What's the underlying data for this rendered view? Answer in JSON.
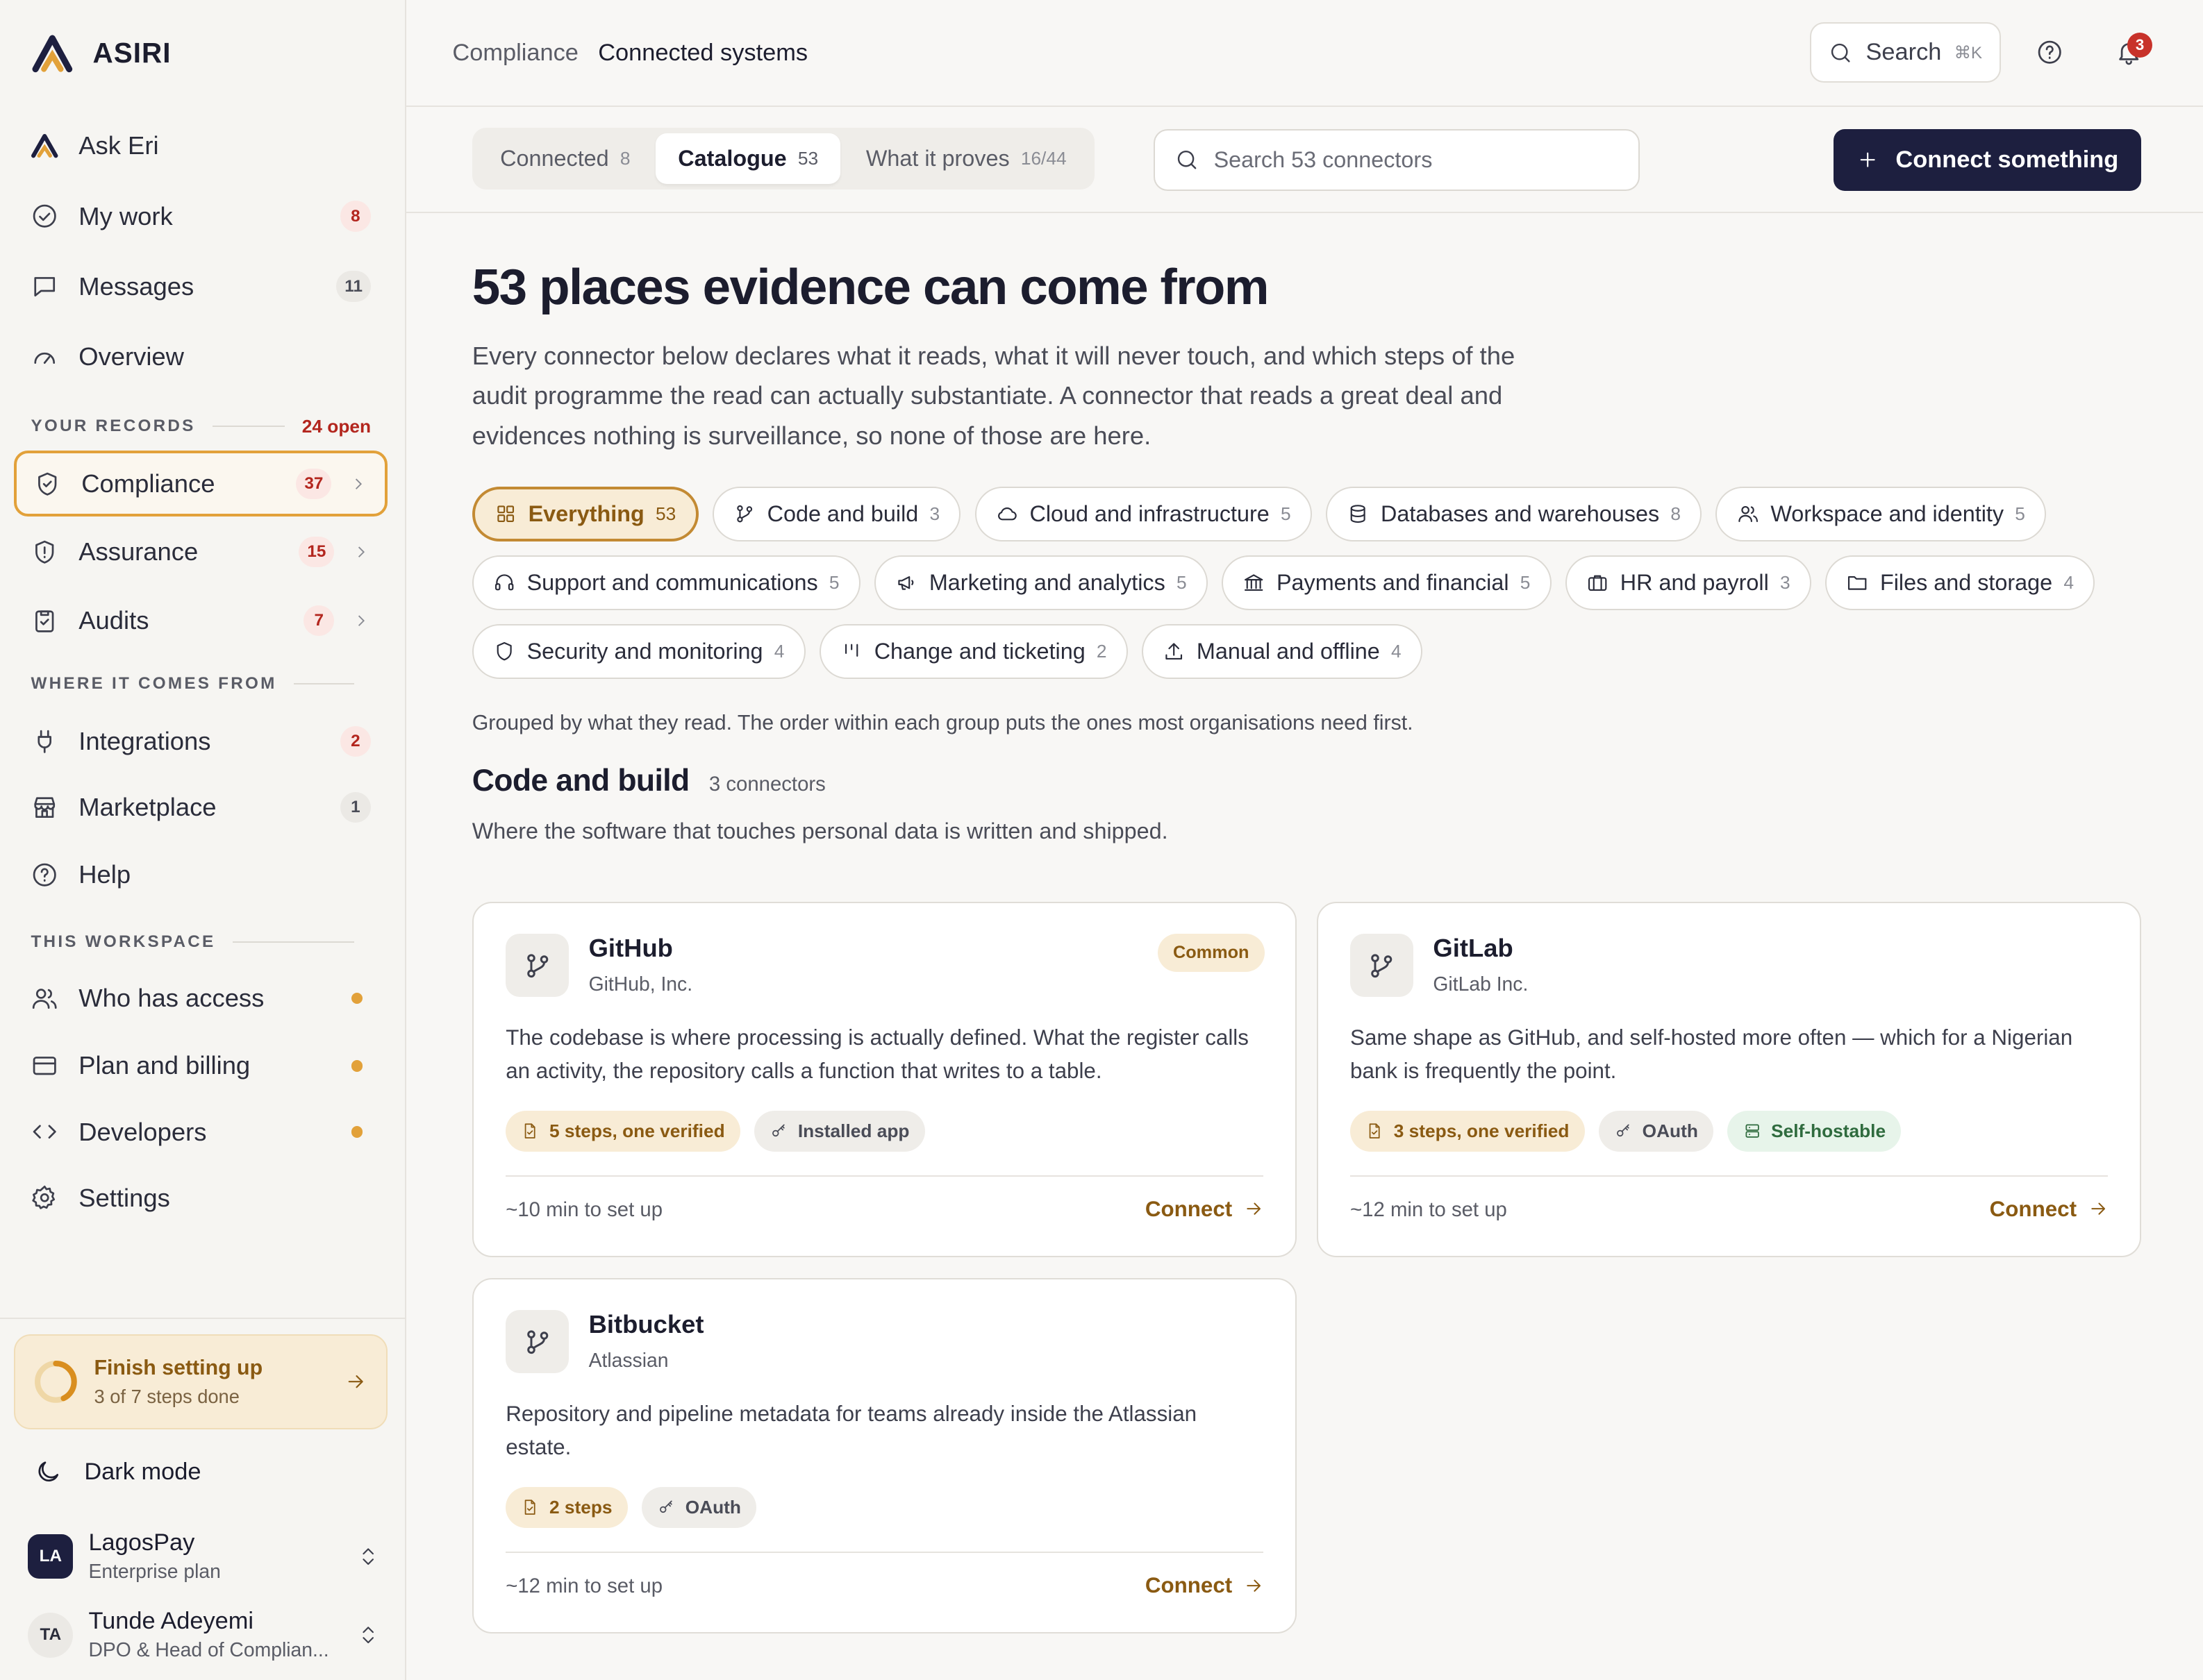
{
  "brand": {
    "name": "ASIRI"
  },
  "sidebar": {
    "top_items": [
      {
        "label": "Ask Eri"
      },
      {
        "label": "My work",
        "badge": "8"
      },
      {
        "label": "Messages",
        "badge": "11"
      },
      {
        "label": "Overview"
      }
    ],
    "records": {
      "heading": "YOUR RECORDS",
      "open": "24 open",
      "items": [
        {
          "label": "Compliance",
          "badge": "37"
        },
        {
          "label": "Assurance",
          "badge": "15"
        },
        {
          "label": "Audits",
          "badge": "7"
        }
      ]
    },
    "sources": {
      "heading": "WHERE IT COMES FROM",
      "items": [
        {
          "label": "Integrations",
          "badge": "2"
        },
        {
          "label": "Marketplace",
          "badge": "1"
        },
        {
          "label": "Help"
        }
      ]
    },
    "workspace": {
      "heading": "THIS WORKSPACE",
      "items": [
        {
          "label": "Who has access"
        },
        {
          "label": "Plan and billing"
        },
        {
          "label": "Developers"
        },
        {
          "label": "Settings"
        }
      ]
    },
    "setup": {
      "title": "Finish setting up",
      "subtitle": "3 of 7 steps done",
      "progress": 0.43
    },
    "dark_mode": "Dark mode",
    "org": {
      "initials": "LA",
      "name": "LagosPay",
      "plan": "Enterprise plan"
    },
    "user": {
      "initials": "TA",
      "name": "Tunde Adeyemi",
      "role": "DPO & Head of Complian..."
    }
  },
  "topbar": {
    "breadcrumb": [
      "Compliance",
      "Connected systems"
    ],
    "search_label": "Search",
    "search_shortcut": "⌘K",
    "notifications": "3"
  },
  "tabs": [
    {
      "label": "Connected",
      "count": "8"
    },
    {
      "label": "Catalogue",
      "count": "53",
      "active": true
    },
    {
      "label": "What it proves",
      "count": "16/44"
    }
  ],
  "connector_search": {
    "placeholder": "Search 53 connectors"
  },
  "connect_button": "Connect something",
  "page": {
    "title": "53 places evidence can come from",
    "intro": "Every connector below declares what it reads, what it will never touch, and which steps of the audit programme the read can actually substantiate. A connector that reads a great deal and evidences nothing is surveillance, so none of those are here.",
    "filters": [
      {
        "label": "Everything",
        "count": "53",
        "icon": "grid-icon",
        "active": true
      },
      {
        "label": "Code and build",
        "count": "3",
        "icon": "git-branch-icon"
      },
      {
        "label": "Cloud and infrastructure",
        "count": "5",
        "icon": "cloud-icon"
      },
      {
        "label": "Databases and warehouses",
        "count": "8",
        "icon": "database-icon"
      },
      {
        "label": "Workspace and identity",
        "count": "5",
        "icon": "users-icon"
      },
      {
        "label": "Support and communications",
        "count": "5",
        "icon": "headset-icon"
      },
      {
        "label": "Marketing and analytics",
        "count": "5",
        "icon": "megaphone-icon"
      },
      {
        "label": "Payments and financial",
        "count": "5",
        "icon": "bank-icon"
      },
      {
        "label": "HR and payroll",
        "count": "3",
        "icon": "briefcase-icon"
      },
      {
        "label": "Files and storage",
        "count": "4",
        "icon": "folder-icon"
      },
      {
        "label": "Security and monitoring",
        "count": "4",
        "icon": "shield-icon"
      },
      {
        "label": "Change and ticketing",
        "count": "2",
        "icon": "kanban-icon"
      },
      {
        "label": "Manual and offline",
        "count": "4",
        "icon": "upload-icon"
      }
    ],
    "note": "Grouped by what they read. The order within each group puts the ones most organisations need first.",
    "group": {
      "title": "Code and build",
      "count": "3 connectors",
      "description": "Where the software that touches personal data is written and shipped."
    },
    "connectors": [
      {
        "name": "GitHub",
        "vendor": "GitHub, Inc.",
        "badge": "Common",
        "description": "The codebase is where processing is actually defined. What the register calls an activity, the repository calls a function that writes to a table.",
        "tags": [
          {
            "label": "5 steps, one verified",
            "style": "amber",
            "icon": "file-check-icon"
          },
          {
            "label": "Installed app",
            "style": "gray",
            "icon": "key-icon"
          }
        ],
        "setup_time": "~10 min to set up",
        "cta": "Connect"
      },
      {
        "name": "GitLab",
        "vendor": "GitLab Inc.",
        "badge": "",
        "description": "Same shape as GitHub, and self-hosted more often — which for a Nigerian bank is frequently the point.",
        "tags": [
          {
            "label": "3 steps, one verified",
            "style": "amber",
            "icon": "file-check-icon"
          },
          {
            "label": "OAuth",
            "style": "gray",
            "icon": "key-icon"
          },
          {
            "label": "Self-hostable",
            "style": "green",
            "icon": "server-icon"
          }
        ],
        "setup_time": "~12 min to set up",
        "cta": "Connect"
      },
      {
        "name": "Bitbucket",
        "vendor": "Atlassian",
        "badge": "",
        "description": "Repository and pipeline metadata for teams already inside the Atlassian estate.",
        "tags": [
          {
            "label": "2 steps",
            "style": "amber",
            "icon": "file-check-icon"
          },
          {
            "label": "OAuth",
            "style": "gray",
            "icon": "key-icon"
          }
        ],
        "setup_time": "~12 min to set up",
        "cta": "Connect"
      }
    ]
  },
  "colors": {
    "accent": "#e2a13a",
    "primary_button": "#1d1f3f",
    "danger": "#b3261e"
  }
}
